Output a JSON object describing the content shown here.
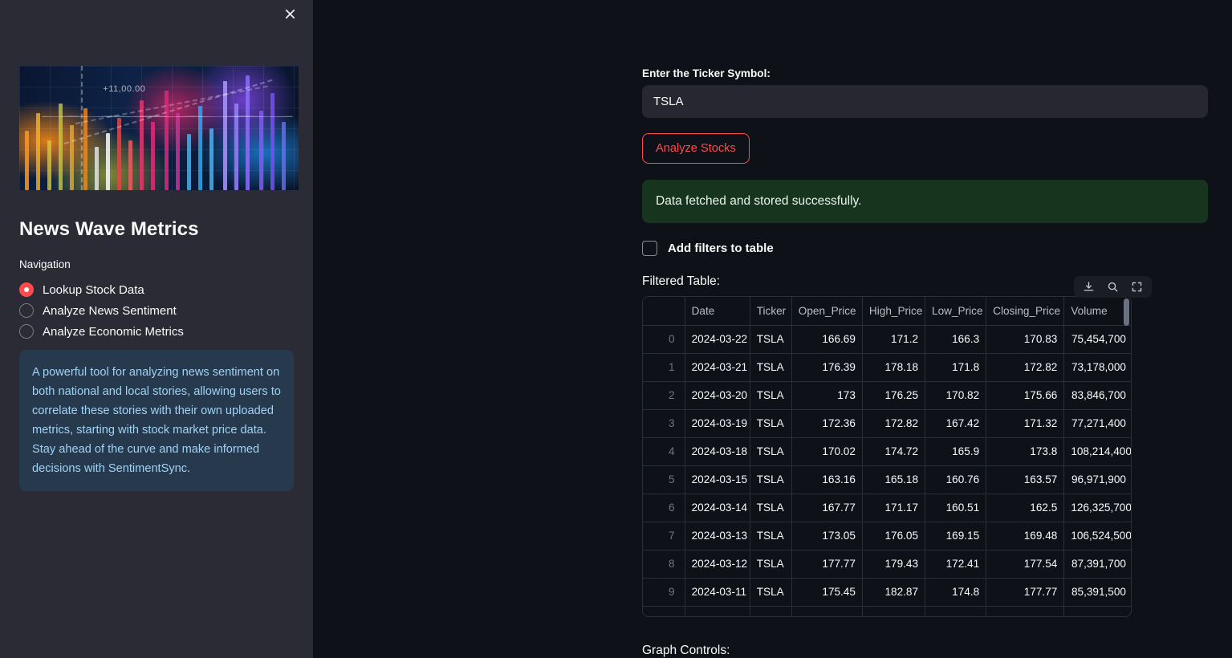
{
  "sidebar": {
    "close_icon": "close-icon",
    "hero": {
      "alt": "stock-market-chart-image",
      "overlay_text": "+11,00.00"
    },
    "title": "News Wave Metrics",
    "nav_label": "Navigation",
    "nav_items": [
      {
        "label": "Lookup Stock Data",
        "selected": true
      },
      {
        "label": "Analyze News Sentiment",
        "selected": false
      },
      {
        "label": "Analyze Economic Metrics",
        "selected": false
      }
    ],
    "info_text": "A powerful tool for analyzing news sentiment on both national and local stories, allowing users to correlate these stories with their own uploaded metrics, starting with stock market price data. Stay ahead of the curve and make informed decisions with SentimentSync."
  },
  "main": {
    "ticker_label": "Enter the Ticker Symbol:",
    "ticker_value": "TSLA",
    "ticker_placeholder": "",
    "analyze_button": "Analyze Stocks",
    "success_message": "Data fetched and stored successfully.",
    "filters_checkbox_label": "Add filters to table",
    "filters_checked": false,
    "table_heading": "Filtered Table:",
    "toolbar_icons": [
      "download-icon",
      "search-icon",
      "fullscreen-icon"
    ],
    "graph_controls_label": "Graph Controls:"
  },
  "table": {
    "columns": [
      "",
      "Date",
      "Ticker",
      "Open_Price",
      "High_Price",
      "Low_Price",
      "Closing_Price",
      "Volume"
    ],
    "rows": [
      {
        "idx": "0",
        "date": "2024-03-22",
        "ticker": "TSLA",
        "open": "166.69",
        "high": "171.2",
        "low": "166.3",
        "close": "170.83",
        "volume": "75,454,700"
      },
      {
        "idx": "1",
        "date": "2024-03-21",
        "ticker": "TSLA",
        "open": "176.39",
        "high": "178.18",
        "low": "171.8",
        "close": "172.82",
        "volume": "73,178,000"
      },
      {
        "idx": "2",
        "date": "2024-03-20",
        "ticker": "TSLA",
        "open": "173",
        "high": "176.25",
        "low": "170.82",
        "close": "175.66",
        "volume": "83,846,700"
      },
      {
        "idx": "3",
        "date": "2024-03-19",
        "ticker": "TSLA",
        "open": "172.36",
        "high": "172.82",
        "low": "167.42",
        "close": "171.32",
        "volume": "77,271,400"
      },
      {
        "idx": "4",
        "date": "2024-03-18",
        "ticker": "TSLA",
        "open": "170.02",
        "high": "174.72",
        "low": "165.9",
        "close": "173.8",
        "volume": "108,214,400"
      },
      {
        "idx": "5",
        "date": "2024-03-15",
        "ticker": "TSLA",
        "open": "163.16",
        "high": "165.18",
        "low": "160.76",
        "close": "163.57",
        "volume": "96,971,900"
      },
      {
        "idx": "6",
        "date": "2024-03-14",
        "ticker": "TSLA",
        "open": "167.77",
        "high": "171.17",
        "low": "160.51",
        "close": "162.5",
        "volume": "126,325,700"
      },
      {
        "idx": "7",
        "date": "2024-03-13",
        "ticker": "TSLA",
        "open": "173.05",
        "high": "176.05",
        "low": "169.15",
        "close": "169.48",
        "volume": "106,524,500"
      },
      {
        "idx": "8",
        "date": "2024-03-12",
        "ticker": "TSLA",
        "open": "177.77",
        "high": "179.43",
        "low": "172.41",
        "close": "177.54",
        "volume": "87,391,700"
      },
      {
        "idx": "9",
        "date": "2024-03-11",
        "ticker": "TSLA",
        "open": "175.45",
        "high": "182.87",
        "low": "174.8",
        "close": "177.77",
        "volume": "85,391,500"
      }
    ]
  },
  "colors": {
    "sidebar_bg": "#2b2b35",
    "main_bg": "#0e1117",
    "accent_red": "#ff4b4b",
    "success_bg": "#17341f",
    "info_bg": "#26394d",
    "info_text": "#9fd3f5",
    "input_bg": "#262730",
    "border": "#2b3038"
  }
}
